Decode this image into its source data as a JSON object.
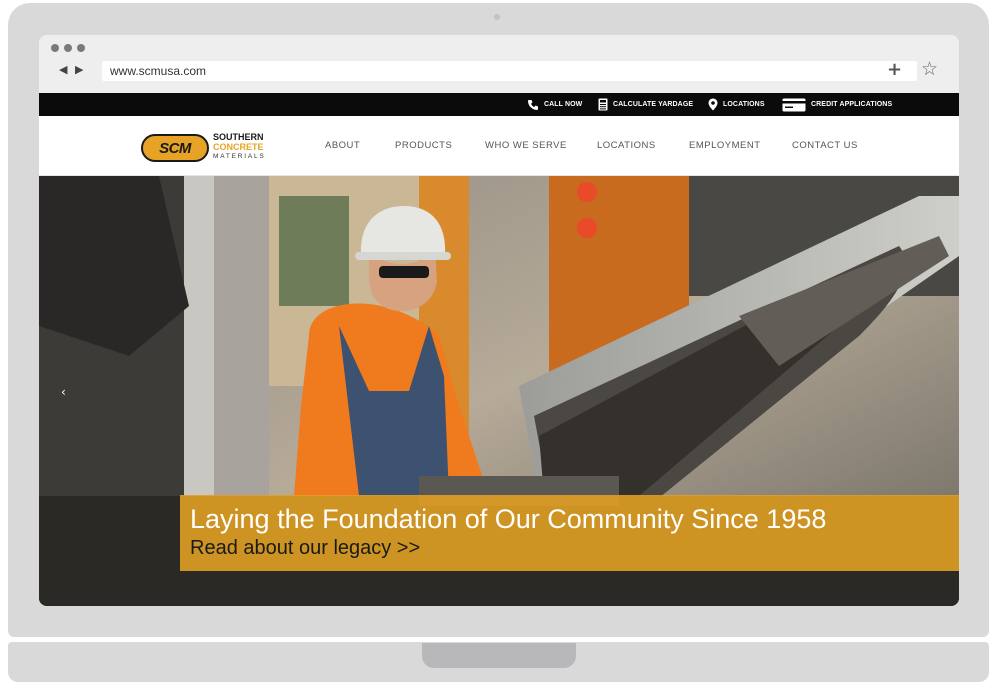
{
  "browser": {
    "url": "www.scmusa.com",
    "nav_arrows": "◀ ▶",
    "plus_glyph": "+",
    "star_glyph": "☆"
  },
  "utility_nav": {
    "items": [
      {
        "label": "CALL NOW",
        "icon": "phone-icon"
      },
      {
        "label": "CALCULATE YARDAGE",
        "icon": "calculator-icon"
      },
      {
        "label": "LOCATIONS",
        "icon": "map-pin-icon"
      },
      {
        "label": "CREDIT APPLICATIONS",
        "icon": "credit-card-icon"
      }
    ]
  },
  "logo": {
    "mark": "SCM",
    "line1": "SOUTHERN",
    "line2": "CONCRETE",
    "line3": "MATERIALS"
  },
  "main_nav": {
    "items": [
      "ABOUT",
      "PRODUCTS",
      "WHO WE SERVE",
      "LOCATIONS",
      "EMPLOYMENT",
      "CONTACT US"
    ]
  },
  "hero": {
    "prev_arrow": "‹",
    "headline": "Laying the Foundation of Our Community Since 1958",
    "link_text": "Read about our legacy >>"
  },
  "colors": {
    "brand_gold": "#e7a325",
    "utility_bar": "#0b0b0b",
    "banner": "#e0a024"
  }
}
